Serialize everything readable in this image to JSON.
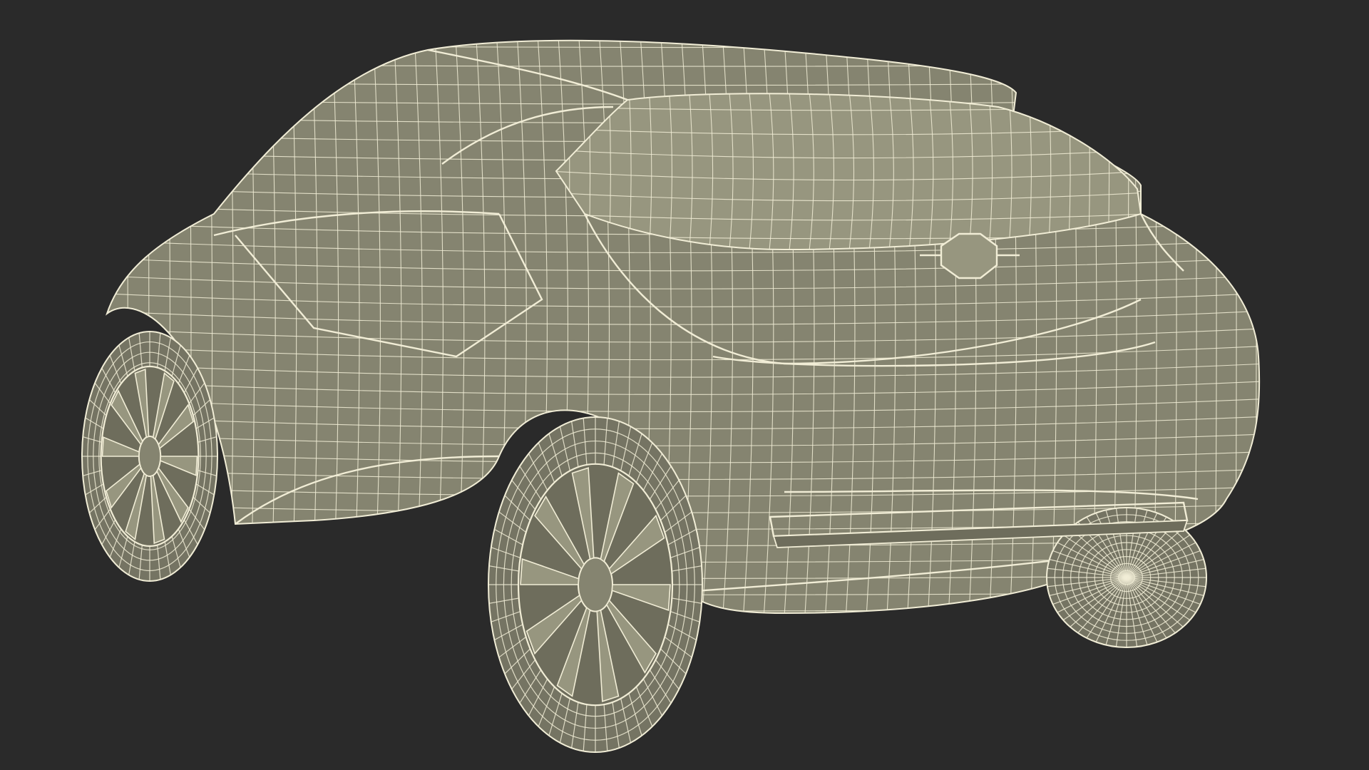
{
  "scene": {
    "background_color": "#2a2a2a",
    "body_fill": "#858470",
    "body_fill_dark": "#6e6d5c",
    "body_fill_light": "#97967f",
    "tire_fill": "#757463",
    "shadow_fill": "#55544a",
    "wire_color": "#f1edd6",
    "subject_icon": "wireframe-car-rear-three-quarter-icon"
  }
}
